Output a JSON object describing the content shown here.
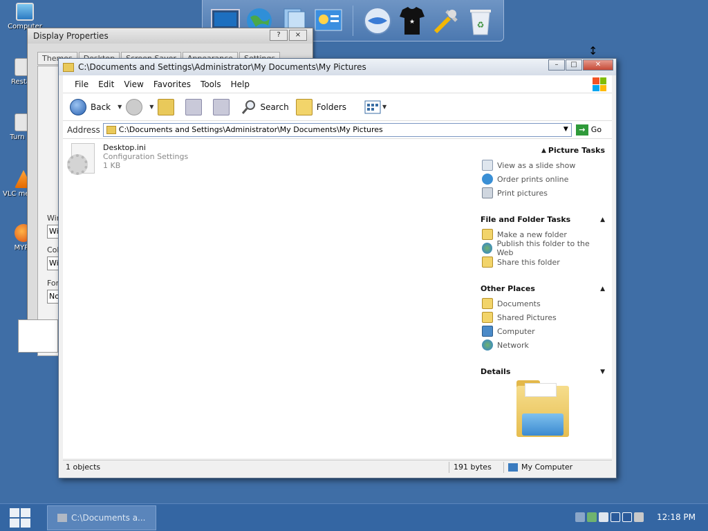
{
  "desktop": {
    "icons": [
      {
        "label": "Computer",
        "icon": "computer-icon"
      },
      {
        "label": "Restart",
        "icon": "restart-icon"
      },
      {
        "label": "Turn Off",
        "icon": "power-icon"
      },
      {
        "label": "VLC media player",
        "icon": "vlc-icon"
      },
      {
        "label": "MYPA",
        "icon": "firefox-icon"
      }
    ]
  },
  "dock": {
    "items": [
      "display-icon",
      "internet-icon",
      "files-icon",
      "chart-icon",
      "globe-icon",
      "shirt-icon",
      "tools-icon",
      "recycle-bin-icon"
    ]
  },
  "display_properties": {
    "title": "Display Properties",
    "help_btn": "?",
    "close_btn": "×",
    "tabs": [
      "Themes",
      "Desktop",
      "Screen Saver",
      "Appearance",
      "Settings"
    ],
    "field_labels": [
      "Wind",
      "Colo",
      "Font"
    ],
    "field_values": [
      "Win",
      "Win",
      "Nor"
    ]
  },
  "explorer": {
    "title": "C:\\Documents and Settings\\Administrator\\My Documents\\My Pictures",
    "menu": [
      "File",
      "Edit",
      "View",
      "Favorites",
      "Tools",
      "Help"
    ],
    "toolbar": {
      "back": "Back",
      "search": "Search",
      "folders": "Folders"
    },
    "address": {
      "label": "Address",
      "value": "C:\\Documents and Settings\\Administrator\\My Documents\\My Pictures",
      "go": "Go"
    },
    "file": {
      "name": "Desktop.ini",
      "type": "Configuration Settings",
      "size": "1 KB"
    },
    "task_pane": {
      "picture_tasks": {
        "title": "Picture Tasks",
        "links": [
          "View as a slide show",
          "Order prints online",
          "Print pictures"
        ]
      },
      "file_folder_tasks": {
        "title": "File and Folder Tasks",
        "links": [
          "Make a new folder",
          "Publish this folder to the Web",
          "Share this folder"
        ]
      },
      "other_places": {
        "title": "Other Places",
        "links": [
          "Documents",
          "Shared Pictures",
          "Computer",
          "Network"
        ]
      },
      "details": {
        "title": "Details"
      }
    },
    "status": {
      "objects": "1 objects",
      "size": "191 bytes",
      "location": "My Computer"
    }
  },
  "taskbar": {
    "task_label": "C:\\Documents a...",
    "clock": "12:18 PM"
  },
  "colors": {
    "desktop_bg": "#3f6ea6",
    "taskbar": "#3466a3",
    "close_button": "#c64a36"
  }
}
